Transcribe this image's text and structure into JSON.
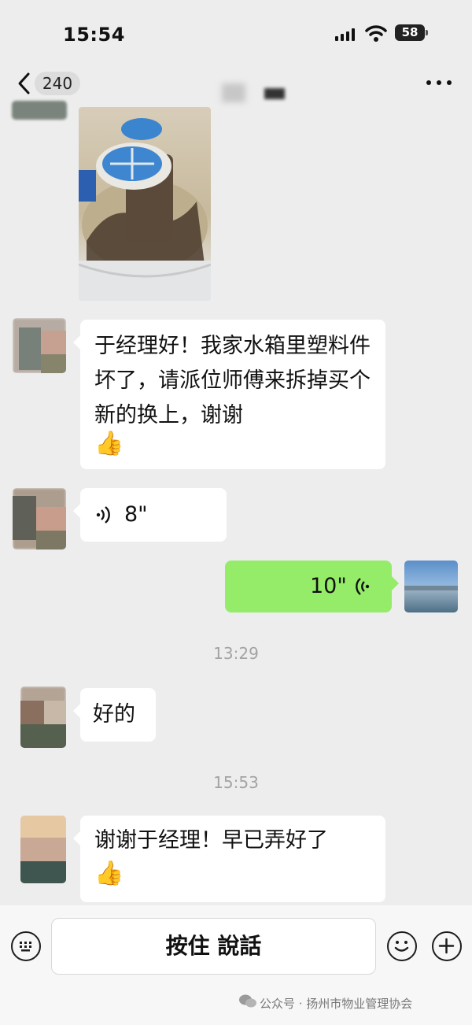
{
  "status_bar": {
    "time": "15:54",
    "battery": "58"
  },
  "header": {
    "unread_count": "240"
  },
  "messages": {
    "m1_text": "于经理好！我家水箱里塑料件坏了，请派位师傅来拆掉买个新的换上，谢谢",
    "m2_voice_duration": "8\"",
    "m3_voice_duration": "10\"",
    "time1": "13:29",
    "m4_text": "好的",
    "time2": "15:53",
    "m5_text": "谢谢于经理！早已弄好了"
  },
  "input_bar": {
    "hold_to_talk_label": "按住 說話"
  },
  "watermark": {
    "text": "公众号 · 扬州市物业管理协会"
  },
  "icons": {
    "back": "chevron-left-icon",
    "more": "more-dots-icon",
    "voice": "voice-wave-icon",
    "emoji": "emoji-icon",
    "plus": "plus-icon",
    "keyboard": "keyboard-icon",
    "thumbs": "thumbs-up-emoji-icon"
  },
  "colors": {
    "background": "#ededed",
    "self_bubble": "#95ec69",
    "other_bubble": "#ffffff"
  }
}
